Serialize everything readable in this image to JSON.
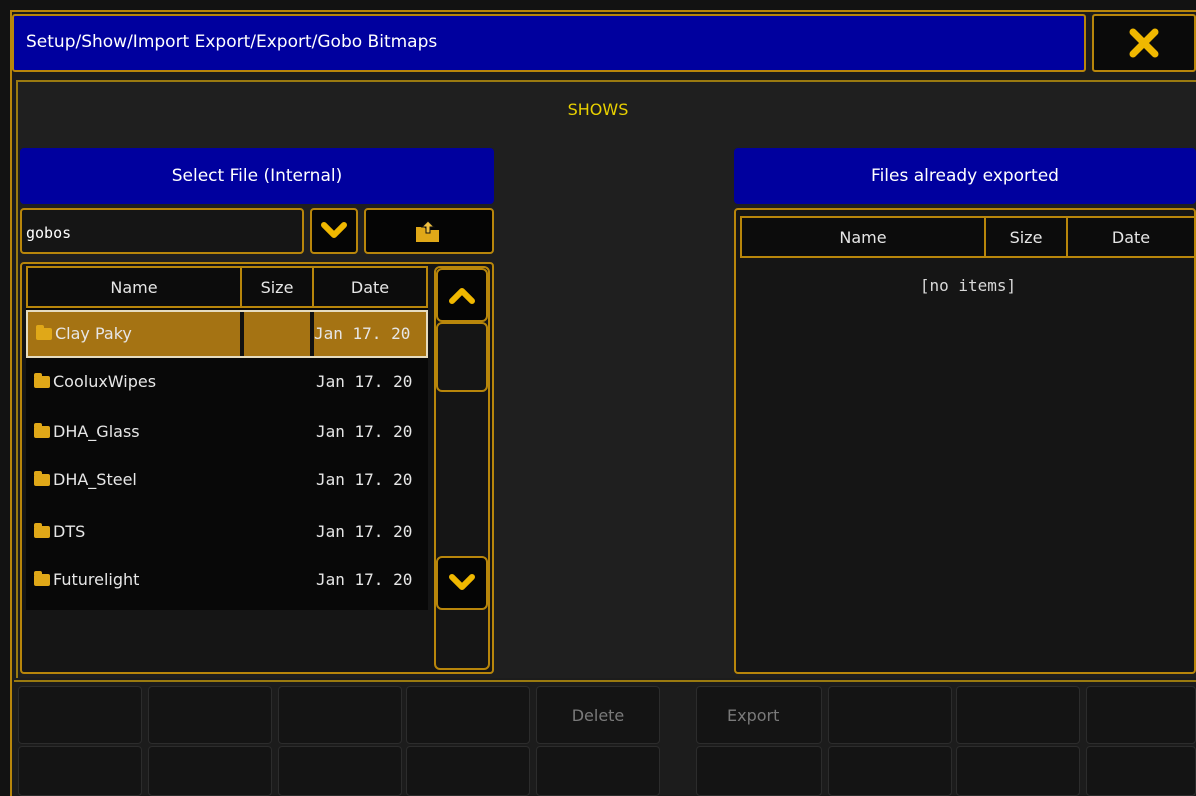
{
  "window": {
    "title": "Setup/Show/Import Export/Export/Gobo Bitmaps",
    "close_icon": "close-icon"
  },
  "section_label": "SHOWS",
  "left_panel": {
    "header": "Select File (Internal)",
    "path_value": "gobos",
    "columns": [
      "Name",
      "Size",
      "Date"
    ],
    "rows": [
      {
        "name": "Clay Paky",
        "size": "",
        "date": "Jan 17. 20",
        "selected": true
      },
      {
        "name": "CooluxWipes",
        "size": "",
        "date": "Jan 17. 20",
        "selected": false
      },
      {
        "name": "DHA_Glass",
        "size": "",
        "date": "Jan 17. 20",
        "selected": false
      },
      {
        "name": "DHA_Steel",
        "size": "",
        "date": "Jan 17. 20",
        "selected": false
      },
      {
        "name": "DTS",
        "size": "",
        "date": "Jan 17. 20",
        "selected": false
      },
      {
        "name": "Futurelight",
        "size": "",
        "date": "Jan 17. 20",
        "selected": false
      }
    ]
  },
  "right_panel": {
    "header": "Files already exported",
    "columns": [
      "Name",
      "Size",
      "Date"
    ],
    "empty_text": "[no items]"
  },
  "bottom_bar": {
    "delete_label": "Delete",
    "export_label": "Export"
  },
  "colors": {
    "accent_gold": "#b8860b",
    "header_blue": "#00009e",
    "selection": "#a57313",
    "section_yellow": "#e8d000"
  }
}
